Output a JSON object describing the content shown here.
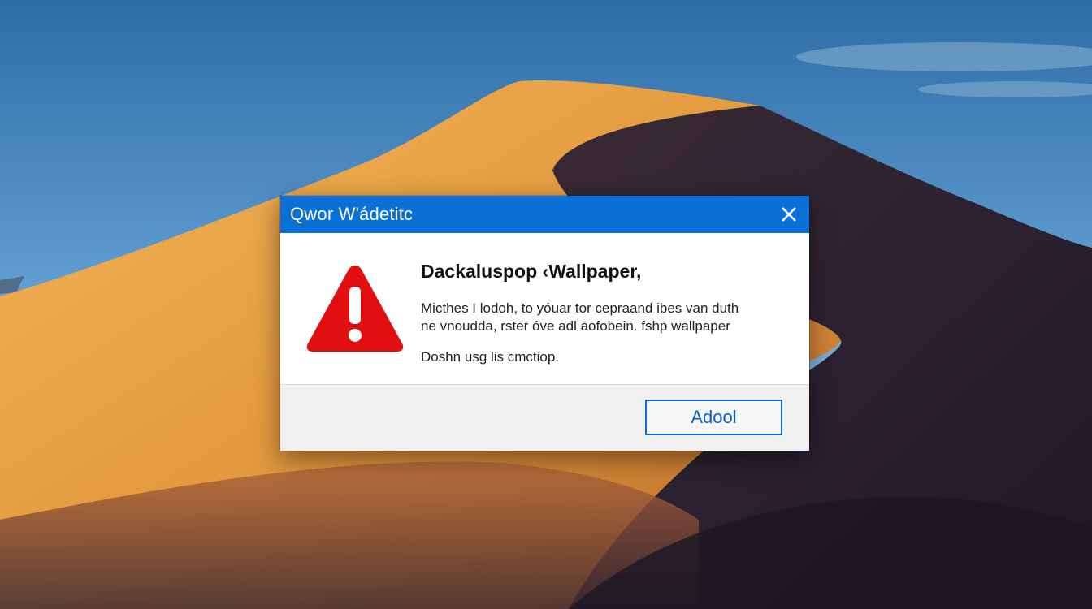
{
  "dialog": {
    "title": "Qwor W'ádetitc",
    "close_icon": "close-icon",
    "heading": "Dackalusрор ‹Wallpaper,",
    "message_lines": [
      "Micthes I lodoh, to yóuar tor cepraand ibes van duth",
      "ne vnoudda, rster óve adl aofobein. fshp wallpaper"
    ],
    "subtext": "Doshn usg lis cmctiop.",
    "button_label": "Adool",
    "warning_icon": "warning-triangle-icon"
  },
  "colors": {
    "title_bar": "#0a6fd6",
    "warning": "#e01010",
    "button_border": "#0a6fd6"
  }
}
